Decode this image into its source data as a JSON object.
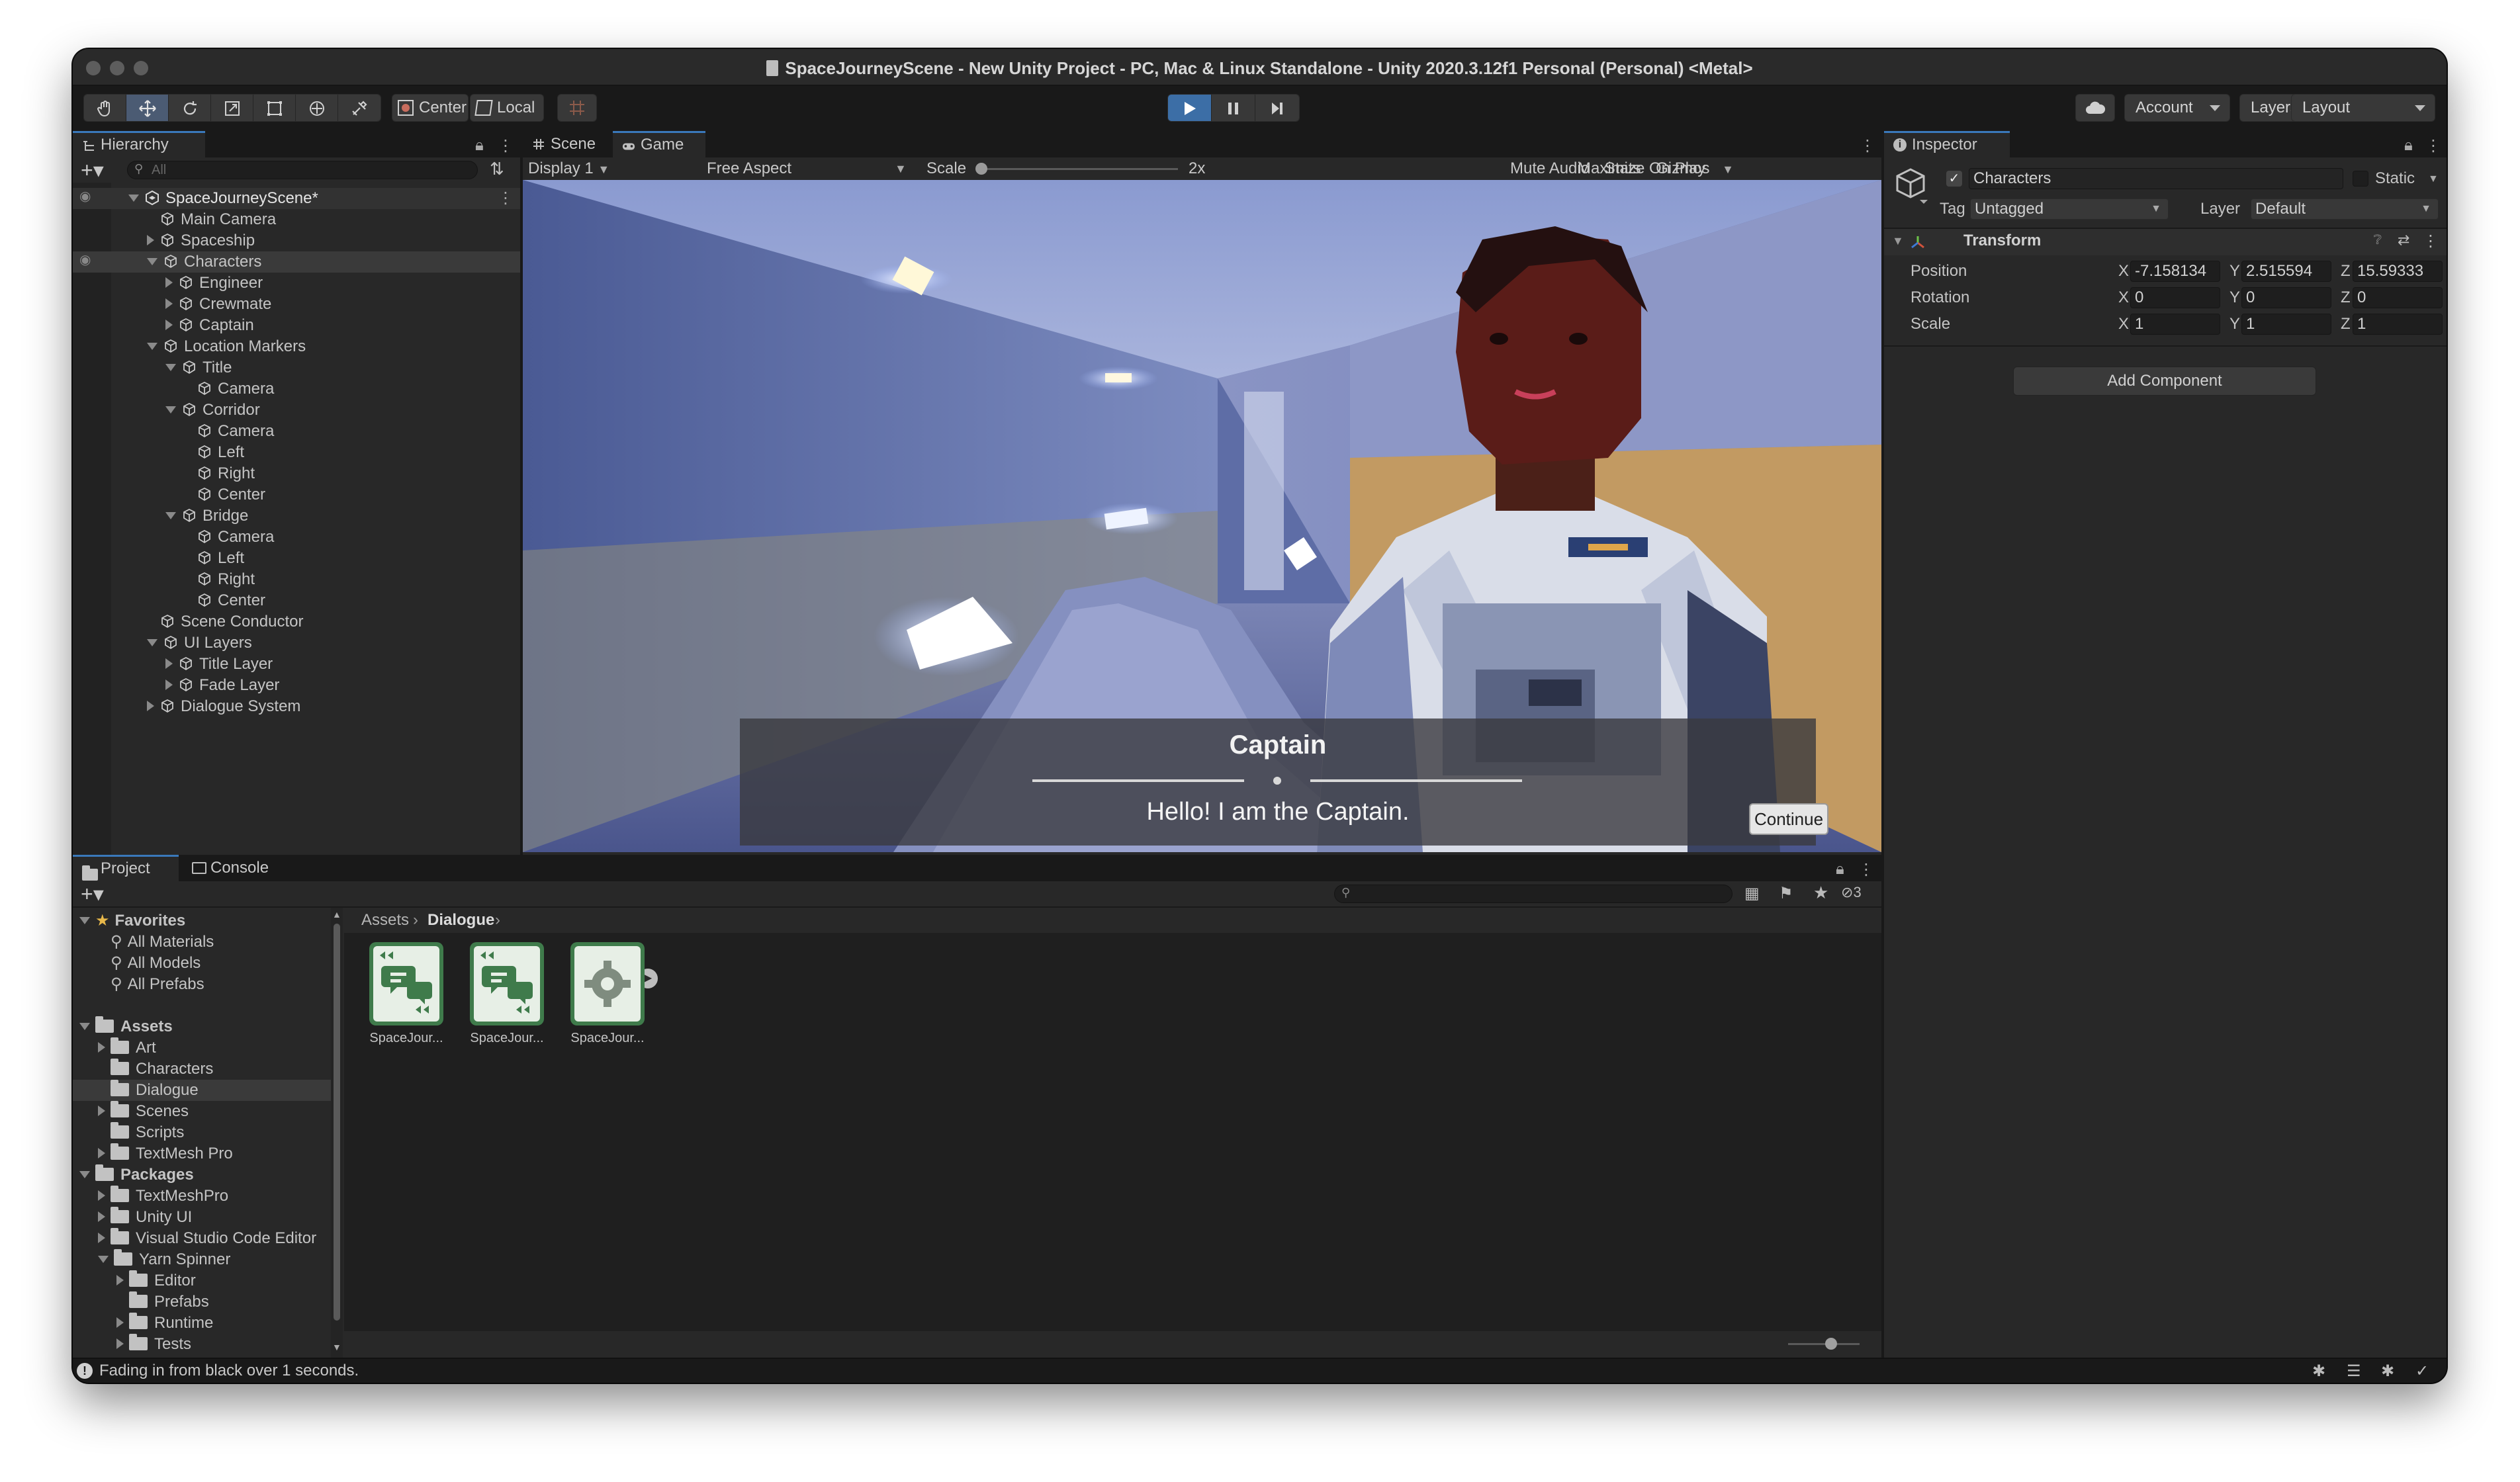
{
  "window": {
    "title": "SpaceJourneyScene - New Unity Project - PC, Mac & Linux Standalone - Unity 2020.3.12f1 Personal (Personal) <Metal>"
  },
  "toolbar": {
    "pivot_label": "Center",
    "space_label": "Local",
    "account_label": "Account",
    "layers_label": "Layers",
    "layout_label": "Layout"
  },
  "hierarchy": {
    "tab_label": "Hierarchy",
    "search_placeholder": "All",
    "items": [
      {
        "label": "SpaceJourneyScene*",
        "depth": 0
      },
      {
        "label": "Main Camera",
        "depth": 1
      },
      {
        "label": "Spaceship",
        "depth": 1
      },
      {
        "label": "Characters",
        "depth": 1
      },
      {
        "label": "Engineer",
        "depth": 2
      },
      {
        "label": "Crewmate",
        "depth": 2
      },
      {
        "label": "Captain",
        "depth": 2
      },
      {
        "label": "Location Markers",
        "depth": 1
      },
      {
        "label": "Title",
        "depth": 2
      },
      {
        "label": "Camera",
        "depth": 3
      },
      {
        "label": "Corridor",
        "depth": 2
      },
      {
        "label": "Camera",
        "depth": 3
      },
      {
        "label": "Left",
        "depth": 3
      },
      {
        "label": "Right",
        "depth": 3
      },
      {
        "label": "Center",
        "depth": 3
      },
      {
        "label": "Bridge",
        "depth": 2
      },
      {
        "label": "Camera",
        "depth": 3
      },
      {
        "label": "Left",
        "depth": 3
      },
      {
        "label": "Right",
        "depth": 3
      },
      {
        "label": "Center",
        "depth": 3
      },
      {
        "label": "Scene Conductor",
        "depth": 1
      },
      {
        "label": "UI Layers",
        "depth": 1
      },
      {
        "label": "Title Layer",
        "depth": 2
      },
      {
        "label": "Fade Layer",
        "depth": 2
      },
      {
        "label": "Dialogue System",
        "depth": 1
      }
    ]
  },
  "game": {
    "scene_tab": "Scene",
    "game_tab": "Game",
    "display": "Display 1",
    "aspect": "Free Aspect",
    "scale_label": "Scale",
    "scale_value": "2x",
    "maximize": "Maximize On Play",
    "mute": "Mute Audio",
    "stats": "Stats",
    "gizmos": "Gizmos",
    "dialogue_name": "Captain",
    "dialogue_line": "Hello! I am the Captain.",
    "continue": "Continue"
  },
  "inspector": {
    "tab_label": "Inspector",
    "object_name": "Characters",
    "static_label": "Static",
    "tag_label": "Tag",
    "tag_value": "Untagged",
    "layer_label": "Layer",
    "layer_value": "Default",
    "transform_label": "Transform",
    "position_label": "Position",
    "rotation_label": "Rotation",
    "scale_label": "Scale",
    "pos": {
      "x": "-7.158134",
      "y": "2.515594",
      "z": "15.59333"
    },
    "rot": {
      "x": "0",
      "y": "0",
      "z": "0"
    },
    "scl": {
      "x": "1",
      "y": "1",
      "z": "1"
    },
    "add_component": "Add Component",
    "x": "X",
    "y": "Y",
    "z": "Z"
  },
  "project": {
    "project_tab": "Project",
    "console_tab": "Console",
    "hidden_count": "3",
    "breadcrumb_root": "Assets",
    "breadcrumb_current": "Dialogue",
    "tree": [
      {
        "label": "Favorites",
        "depth": 0,
        "kind": "star"
      },
      {
        "label": "All Materials",
        "depth": 1,
        "kind": "search"
      },
      {
        "label": "All Models",
        "depth": 1,
        "kind": "search"
      },
      {
        "label": "All Prefabs",
        "depth": 1,
        "kind": "search"
      },
      {
        "label": "",
        "depth": 0,
        "kind": "blank"
      },
      {
        "label": "Assets",
        "depth": 0,
        "kind": "folder-open"
      },
      {
        "label": "Art",
        "depth": 1,
        "kind": "folder"
      },
      {
        "label": "Characters",
        "depth": 1,
        "kind": "folder"
      },
      {
        "label": "Dialogue",
        "depth": 1,
        "kind": "folder"
      },
      {
        "label": "Scenes",
        "depth": 1,
        "kind": "folder"
      },
      {
        "label": "Scripts",
        "depth": 1,
        "kind": "folder"
      },
      {
        "label": "TextMesh Pro",
        "depth": 1,
        "kind": "folder"
      },
      {
        "label": "Packages",
        "depth": 0,
        "kind": "folder-open"
      },
      {
        "label": "TextMeshPro",
        "depth": 1,
        "kind": "folder"
      },
      {
        "label": "Unity UI",
        "depth": 1,
        "kind": "folder"
      },
      {
        "label": "Visual Studio Code Editor",
        "depth": 1,
        "kind": "folder"
      },
      {
        "label": "Yarn Spinner",
        "depth": 1,
        "kind": "folder-open"
      },
      {
        "label": "Editor",
        "depth": 2,
        "kind": "folder"
      },
      {
        "label": "Prefabs",
        "depth": 2,
        "kind": "folder"
      },
      {
        "label": "Runtime",
        "depth": 2,
        "kind": "folder"
      },
      {
        "label": "Tests",
        "depth": 2,
        "kind": "folder"
      }
    ],
    "assets": [
      {
        "label": "SpaceJour...",
        "icon": "yarn-dialogue-icon"
      },
      {
        "label": "SpaceJour...",
        "icon": "yarn-dialogue-icon"
      },
      {
        "label": "SpaceJour...",
        "icon": "yarn-project-gear-icon"
      }
    ]
  },
  "status": {
    "message": "Fading in from black over 1 seconds."
  }
}
